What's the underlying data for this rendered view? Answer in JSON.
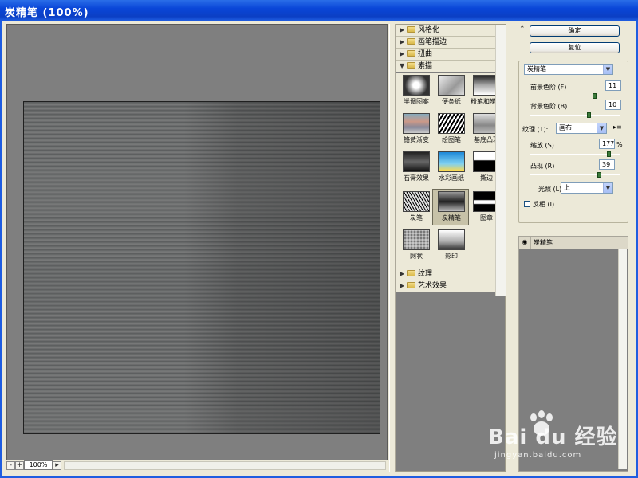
{
  "window": {
    "title": "炭精笔 (100%)"
  },
  "preview": {
    "zoom": "100%",
    "zoom_out": "-",
    "zoom_in": "+"
  },
  "filters": {
    "categories_top": [
      {
        "label": "风格化",
        "expanded": false
      },
      {
        "label": "画笔描边",
        "expanded": false
      },
      {
        "label": "扭曲",
        "expanded": false
      },
      {
        "label": "素描",
        "expanded": true
      }
    ],
    "sketch_items": [
      {
        "label": "半调图案",
        "selected": false
      },
      {
        "label": "便条纸",
        "selected": false
      },
      {
        "label": "粉笔和炭笔",
        "selected": false
      },
      {
        "label": "铬黄渐变",
        "selected": false
      },
      {
        "label": "绘图笔",
        "selected": false
      },
      {
        "label": "基底凸现",
        "selected": false
      },
      {
        "label": "石膏效果",
        "selected": false
      },
      {
        "label": "水彩画纸",
        "selected": false
      },
      {
        "label": "撕边",
        "selected": false
      },
      {
        "label": "炭笔",
        "selected": false
      },
      {
        "label": "炭精笔",
        "selected": true
      },
      {
        "label": "图章",
        "selected": false
      },
      {
        "label": "网状",
        "selected": false
      },
      {
        "label": "影印",
        "selected": false
      }
    ],
    "categories_bottom": [
      {
        "label": "纹理",
        "expanded": false
      },
      {
        "label": "艺术效果",
        "expanded": false
      }
    ]
  },
  "actions": {
    "ok": "确定",
    "reset": "复位"
  },
  "settings": {
    "filter_select": "炭精笔",
    "foreground_label": "前景色阶 (F)",
    "foreground_value": "11",
    "foreground_level": 0.72,
    "background_label": "背景色阶 (B)",
    "background_value": "10",
    "background_level": 0.66,
    "texture_label": "纹理 (T):",
    "texture_value": "画布",
    "scaling_label": "缩放 (S)",
    "scaling_value": "177",
    "scaling_unit": "%",
    "scaling_level": 0.88,
    "relief_label": "凸现 (R)",
    "relief_value": "39",
    "relief_level": 0.78,
    "light_label": "光照 (L):",
    "light_value": "上",
    "invert_label": "反相 (I)",
    "invert_checked": false
  },
  "layers": [
    {
      "name": "炭精笔",
      "visible": true
    }
  ],
  "watermark": {
    "brand": "Bai du 经验",
    "url": "jingyan.baidu.com"
  }
}
